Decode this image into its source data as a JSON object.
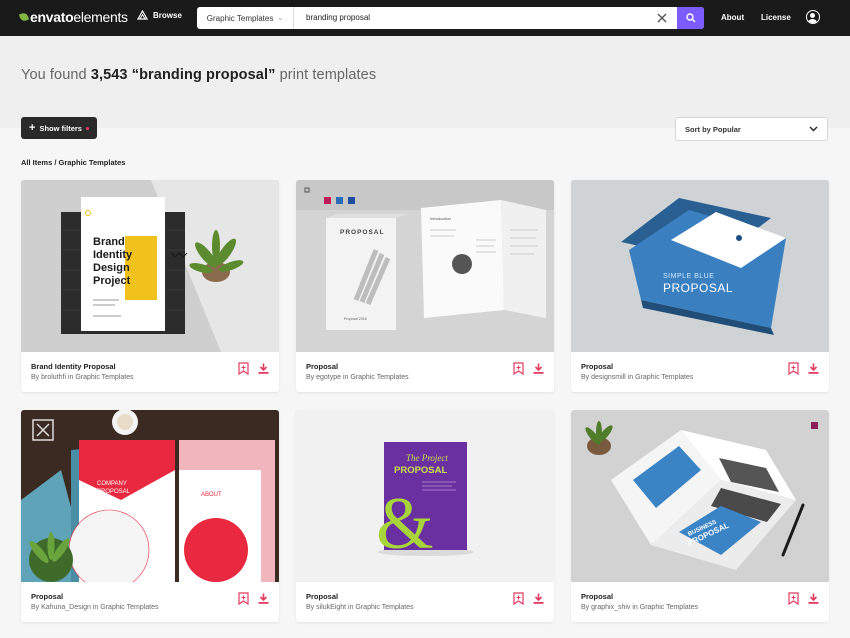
{
  "header": {
    "logo_primary": "envato",
    "logo_secondary": "elements",
    "browse_label": "Browse",
    "category": "Graphic Templates",
    "search_query": "branding proposal",
    "nav_about": "About",
    "nav_license": "License"
  },
  "results": {
    "prefix": "You found ",
    "count": "3,543",
    "query": "“branding proposal”",
    "suffix": " print templates"
  },
  "filters": {
    "label": "Show filters"
  },
  "sort": {
    "label": "Sort by Popular"
  },
  "breadcrumb": "All Items / Graphic Templates",
  "cards": [
    {
      "title": "Brand Identity Proposal",
      "author": "By broluthfi in Graphic Templates"
    },
    {
      "title": "Proposal",
      "author": "By egotype in Graphic Templates"
    },
    {
      "title": "Proposal",
      "author": "By designsmill in Graphic Templates"
    },
    {
      "title": "Proposal",
      "author": "By Kahuna_Design in Graphic Templates"
    },
    {
      "title": "Proposal",
      "author": "By silukEight in Graphic Templates"
    },
    {
      "title": "Proposal",
      "author": "By graphix_shiv in Graphic Templates"
    }
  ],
  "thumbs": {
    "t1": {
      "line1": "Brand",
      "line2": "Identity",
      "line3": "Design",
      "line4": "Project"
    },
    "t2": {
      "cover": "PROPOSAL",
      "year": "Proposal 2018",
      "inside": "Introduction"
    },
    "t3": {
      "line1": "SIMPLE BLUE",
      "line2": "PROPOSAL"
    },
    "t4": {
      "line1": "COMPANY",
      "line2": "PROPOSAL",
      "right": "ABOUT"
    },
    "t5": {
      "line1": "The Project",
      "line2": "PROPOSAL",
      "glyph": "&"
    },
    "t6": {
      "line1": "BUSINESS",
      "line2": "PROPOSAL"
    }
  },
  "colors": {
    "accent": "#7c5cff",
    "action": "#e23b60",
    "topbar": "#1a1a1a"
  }
}
